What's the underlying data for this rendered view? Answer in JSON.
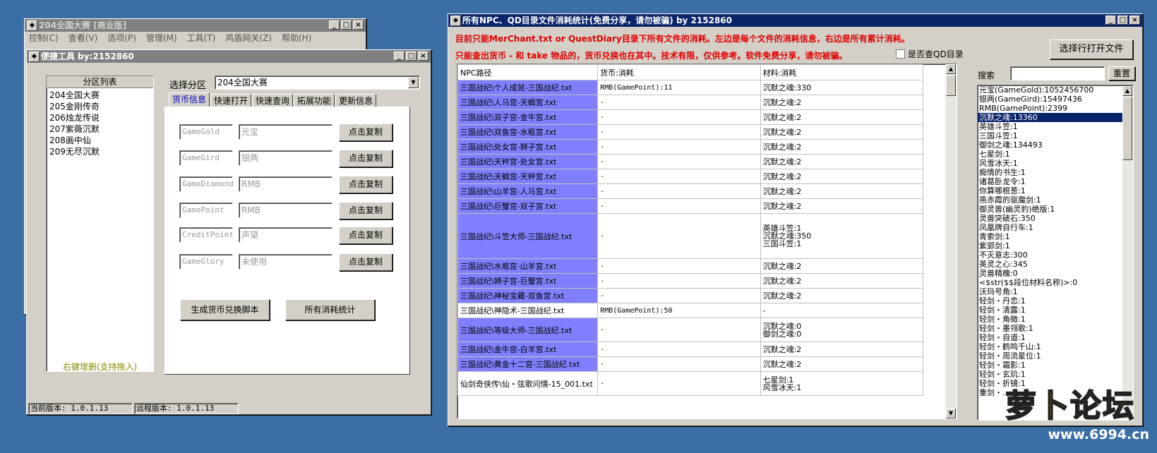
{
  "main_window": {
    "title": "204全国大赛 [商业版]",
    "menu": [
      "控制(C)",
      "查看(V)",
      "选项(P)",
      "管理(M)",
      "工具(T)",
      "鸡盾网关(Z)",
      "帮助(H)"
    ]
  },
  "tool_window": {
    "title": "便捷工具  by:2152860",
    "partition_header": "分区列表",
    "partitions": [
      "204全国大赛",
      "205金刚传奇",
      "206烛龙传说",
      "207紫薇沉默",
      "208画中仙",
      "209无尽沉默"
    ],
    "partition_footer": "右键增删(支持拖入)",
    "select_label": "选择分区",
    "select_value": "204全国大赛",
    "tabs": [
      "货币信息",
      "快速打开",
      "快速查询",
      "拓展功能",
      "更新信息"
    ],
    "currency_rows": [
      {
        "key": "GameGold",
        "name": "元宝",
        "button": "点击复制"
      },
      {
        "key": "GameGird",
        "name": "银两",
        "button": "点击复制"
      },
      {
        "key": "GameDiamond",
        "name": "RMB",
        "button": "点击复制"
      },
      {
        "key": "GamePoint",
        "name": "RMB",
        "button": "点击复制"
      },
      {
        "key": "CreditPoint",
        "name": "声望",
        "button": "点击复制"
      },
      {
        "key": "GameGlory",
        "name": "未使用",
        "button": "点击复制"
      }
    ],
    "gen_button": "生成货币兑换脚本",
    "stats_button": "所有消耗统计",
    "local_version": "当前版本: 1.0.1.13",
    "remote_version": "远程版本: 1.0.1.13"
  },
  "stats_window": {
    "title": "所有NPC、QD目录文件消耗统计(免费分享，请勿被骗)    by 2152860",
    "notice1": "目前只能MerChant.txt or QuestDiary目录下所有文件的消耗。左边是每个文件的消耗信息，右边是所有累计消耗。",
    "notice2": "只能查出货币 - 和 take 物品的，货币兑换也在其中。技术有限，仅供参考。软件免费分享，请勿被骗。",
    "qd_checkbox": "是否查QD目录",
    "open_button": "选择行打开文件",
    "search_label": "搜索",
    "reset_button": "重置",
    "columns": [
      "NPC路径",
      "货币:消耗",
      "材料:消耗"
    ],
    "rows": [
      {
        "path": "三国战纪\\个人成就-三国战纪.txt",
        "currency": "RMB(GamePoint):11",
        "material": [
          "沉默之魂:330"
        ],
        "sel": true
      },
      {
        "path": "三国战纪\\人马宫-天蝎宫.txt",
        "currency": "-",
        "material": [
          "沉默之魂:2"
        ],
        "sel": true
      },
      {
        "path": "三国战纪\\双子宫-金牛宫.txt",
        "currency": "-",
        "material": [
          "沉默之魂:2"
        ],
        "sel": true
      },
      {
        "path": "三国战纪\\双鱼宫-水瓶宫.txt",
        "currency": "-",
        "material": [
          "沉默之魂:2"
        ],
        "sel": true
      },
      {
        "path": "三国战纪\\处女宫-狮子宫.txt",
        "currency": "-",
        "material": [
          "沉默之魂:2"
        ],
        "sel": true
      },
      {
        "path": "三国战纪\\天秤宫-处女宫.txt",
        "currency": "-",
        "material": [
          "沉默之魂:2"
        ],
        "sel": true
      },
      {
        "path": "三国战纪\\天蝎宫-天秤宫.txt",
        "currency": "-",
        "material": [
          "沉默之魂:2"
        ],
        "sel": true
      },
      {
        "path": "三国战纪\\山羊宫-人马宫.txt",
        "currency": "-",
        "material": [
          "沉默之魂:2"
        ],
        "sel": true
      },
      {
        "path": "三国战纪\\巨蟹宫-双子宫.txt",
        "currency": "-",
        "material": [
          "沉默之魂:2"
        ],
        "sel": true
      },
      {
        "path": "三国战纪\\斗笠大师-三国战纪.txt",
        "currency": "-",
        "material": [
          "英雄斗笠:1",
          "沉默之魂:350",
          "三国斗笠:1"
        ],
        "sel": true
      },
      {
        "path": "三国战纪\\水瓶宫-山羊宫.txt",
        "currency": "-",
        "material": [
          "沉默之魂:2"
        ],
        "sel": true
      },
      {
        "path": "三国战纪\\狮子宫-巨蟹宫.txt",
        "currency": "-",
        "material": [
          "沉默之魂:2"
        ],
        "sel": true
      },
      {
        "path": "三国战纪\\神秘宝藏-双鱼宫.txt",
        "currency": "-",
        "material": [
          "沉默之魂:2"
        ],
        "sel": true
      },
      {
        "path": "三国战纪\\神隐术-三国战纪.txt",
        "currency": "RMB(GamePoint):50",
        "material": [
          "-"
        ],
        "sel": false
      },
      {
        "path": "三国战纪\\等级大师-三国战纪.txt",
        "currency": "-",
        "material": [
          "沉默之魂:0",
          "御剑之魂:0"
        ],
        "sel": true
      },
      {
        "path": "三国战纪\\金牛宫-白羊宫.txt",
        "currency": "-",
        "material": [
          "沉默之魂:2"
        ],
        "sel": true
      },
      {
        "path": "三国战纪\\黄金十二宫-三国战纪.txt",
        "currency": "-",
        "material": [
          "沉默之魂:2"
        ],
        "sel": true
      },
      {
        "path": "仙剑奇侠传\\仙・弦歌问情-15_001.txt",
        "currency": "-",
        "material": [
          "七星剑:1",
          "风雪冰天:1"
        ],
        "sel": false
      }
    ],
    "totals": [
      "元宝(GameGold):1052456700",
      "银两(GameGird):15497436",
      "RMB(GamePoint):2399",
      "沉默之魂:13360",
      "英雄斗笠:1",
      "三国斗笠:1",
      "御剑之魂:134493",
      "七星剑:1",
      "风雪冰天:1",
      "痴情的书生:1",
      "诸葛卧龙令:1",
      "你算哪根葱:1",
      "燕赤霞的驱魔剑:1",
      "御灵兽(幽灵豹)绝版:1",
      "灵兽突破石:350",
      "凤凰牌自行车:1",
      "青索剑:1",
      "紫郢剑:1",
      "不灭意志:300",
      "英灵之心:345",
      "灵兽精魄:0",
      "<$str($$段位材料名称)>:0",
      "沃玛号角:1",
      "轻剑・丹恋:1",
      "轻剑・清露:1",
      "轻剑・角徵:1",
      "轻剑・墨翎歌:1",
      "轻剑・自道:1",
      "轻剑・鹤鸣千山:1",
      "轻剑・周流星位:1",
      "轻剑・霜影:1",
      "轻剑・玄玑:1",
      "轻剑・折镜:1",
      "重剑・..."
    ],
    "selected_total_index": 3
  },
  "watermark": {
    "logo_text": "萝卜论坛",
    "url": "www.6994.cn"
  }
}
